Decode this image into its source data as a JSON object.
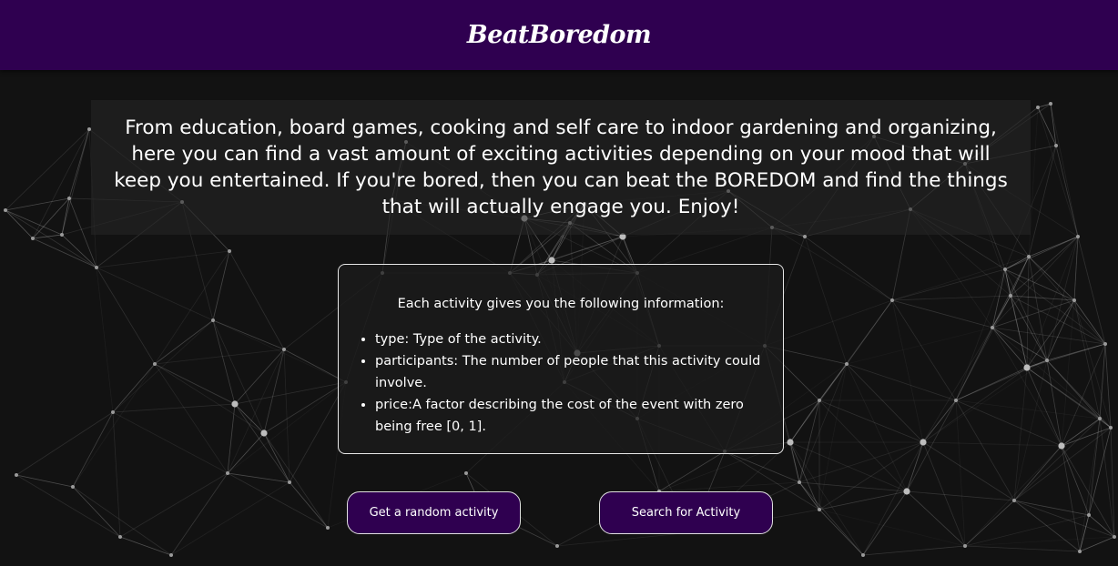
{
  "header": {
    "brand": "BeatBoredom"
  },
  "intro": {
    "text": "From education, board games, cooking and self care to indoor gardening and organizing, here you can find a vast amount of exciting activities depending on your mood that will keep you entertained. If you're bored, then you can beat the BOREDOM and find the things that will actually engage you. Enjoy!"
  },
  "info": {
    "heading": "Each activity gives you the following information:",
    "items": [
      "type: Type of the activity.",
      "participants: The number of people that this activity could involve.",
      "price:A factor describing the cost of the event with zero being free [0, 1]."
    ]
  },
  "buttons": {
    "random_label": "Get a random activity",
    "search_label": "Search for Activity"
  },
  "colors": {
    "header_bg": "#2f0050",
    "page_bg": "#121212",
    "button_bg": "#2f0050",
    "network_lines": "#ffffff"
  }
}
